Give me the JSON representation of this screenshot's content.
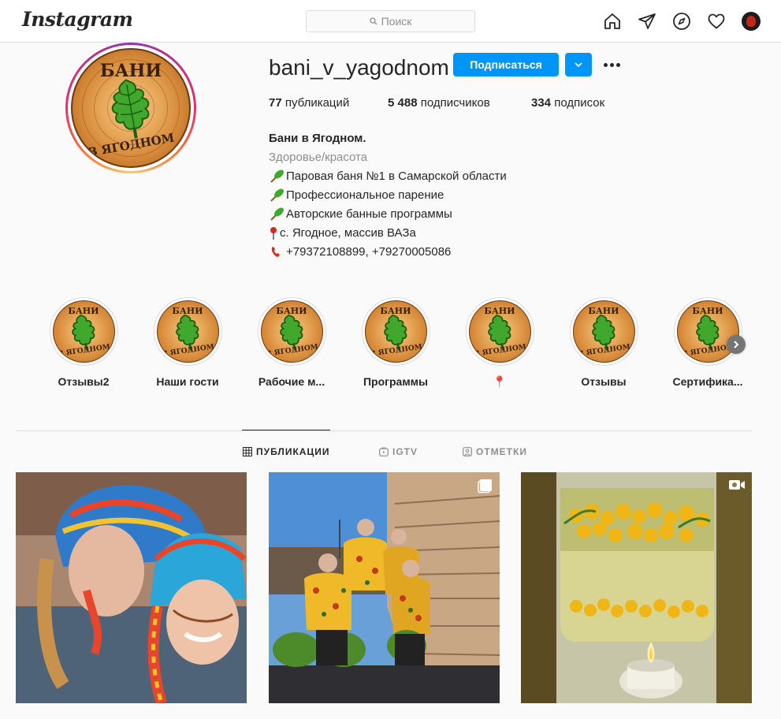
{
  "nav": {
    "logo": "Instagram",
    "search_placeholder": "Поиск",
    "icons": [
      "home-icon",
      "direct-icon",
      "explore-icon",
      "activity-heart-icon",
      "profile-avatar"
    ]
  },
  "profile": {
    "username": "bani_v_yagodnom",
    "follow_label": "Подписаться",
    "pic_text_top": "БАНИ",
    "pic_text_bottom": "В ЯГОДНОМ",
    "stats": {
      "posts_count": "77",
      "posts_label": " публикаций",
      "followers_count": "5 488",
      "followers_label": " подписчиков",
      "following_count": "334",
      "following_label": " подписок"
    },
    "bio": {
      "name": "Бани в Ягодном.",
      "category": "Здоровье/красота",
      "lines": [
        "Паровая баня №1 в Самарской области",
        "Профессиональное парение",
        "Авторские банные программы",
        "с. Ягодное, массив ВАЗа",
        "+79372108899, +79270005086"
      ]
    }
  },
  "highlights": [
    {
      "label": "Отзывы2"
    },
    {
      "label": "Наши гости"
    },
    {
      "label": "Рабочие м..."
    },
    {
      "label": "Программы"
    },
    {
      "label": "📍"
    },
    {
      "label": "Отзывы"
    },
    {
      "label": "Сертифика..."
    }
  ],
  "highlight_disc_text": {
    "top": "БАНИ",
    "bottom": "В ЯГОДНОМ"
  },
  "tabs": [
    {
      "label": "ПУБЛИКАЦИИ",
      "icon": "grid-icon",
      "active": true
    },
    {
      "label": "IGTV",
      "icon": "igtv-icon",
      "active": false
    },
    {
      "label": "ОТМЕТКИ",
      "icon": "tagged-icon",
      "active": false
    }
  ],
  "posts": [
    {
      "type": "photo",
      "subject": "two women in knitted hats"
    },
    {
      "type": "carousel",
      "subject": "four men in floral shirts with brooms"
    },
    {
      "type": "video",
      "subject": "glass teapot with sea buckthorn and candle"
    }
  ],
  "colors": {
    "accent": "#0095f6",
    "text": "#262626",
    "muted": "#8e8e8e",
    "border": "#dbdbdb",
    "bg": "#fafafa"
  }
}
